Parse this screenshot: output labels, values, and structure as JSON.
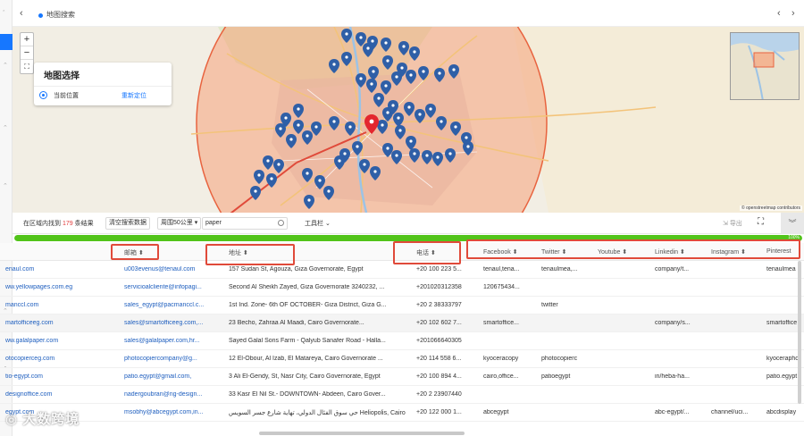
{
  "topbar": {
    "back": "‹",
    "title": "地图搜索",
    "prev": "‹",
    "next": "›"
  },
  "map": {
    "zoom_in": "+",
    "zoom_out": "−",
    "locate": "⛶",
    "panel_title": "地图选择",
    "current_position": "当前位置",
    "relocate": "重新定位",
    "attribution": "© openstreetmap contributors"
  },
  "toolbar": {
    "count_prefix": "在区域内找到",
    "count": "179",
    "count_suffix": "条结果",
    "clear_button": "清空搜索数据",
    "radius_select": "周围50公里",
    "search_value": "paper",
    "tools_label": "工具栏",
    "export_label": "导出"
  },
  "progress": {
    "percent": 100,
    "label": "100%"
  },
  "table": {
    "headers": [
      "邮箱",
      "地址",
      "电话",
      "Facebook",
      "Twitter",
      "Youtube",
      "Linkedin",
      "Instagram",
      "Pinterest"
    ],
    "rows": [
      {
        "web": "enaul.com",
        "email": "u003evenus@tenaul.com",
        "address": "157 Sudan St, Agouza, Giza Governorate, Egypt",
        "phone": "+20 100 223 5...",
        "facebook": "tenaul,tena...",
        "twitter": "tenaulmea,...",
        "youtube": "",
        "linkedin": "company/t...",
        "instagram": "",
        "pinterest": "tenaulmea"
      },
      {
        "web": "ww.yellowpages.com.eg",
        "email": "servicioalcliente@infopagi...",
        "address": "Second Al Sheikh Zayed, Giza Governorate 3240232, ...",
        "phone": "+201020312358",
        "facebook": "120675434...",
        "twitter": "",
        "youtube": "",
        "linkedin": "",
        "instagram": "",
        "pinterest": ""
      },
      {
        "web": "manccl.com",
        "email": "sales_egypt@pacmanccl.c...",
        "address": "1st Ind. Zone- 6th OF OCTOBER- Giza District, Giza G...",
        "phone": "+20 2 38333797",
        "facebook": "",
        "twitter": "twitter",
        "youtube": "",
        "linkedin": "",
        "instagram": "",
        "pinterest": ""
      },
      {
        "web": "martofficeeg.com",
        "email": "sales@smartofficeeg.com,...",
        "address": "23 Becho, Zahraa Al Maadi, Cairo Governorate...",
        "phone": "+20 102 602 7...",
        "facebook": "smartoffice...",
        "twitter": "",
        "youtube": "",
        "linkedin": "company/s...",
        "instagram": "",
        "pinterest": "smartoffice"
      },
      {
        "web": "ww.galalpaper.com",
        "email": "sales@galalpaper.com,hr...",
        "address": "Sayed Galal Sons Farm - Qalyub Sanafer Road - Halla...",
        "phone": "+201066640305",
        "facebook": "",
        "twitter": "",
        "youtube": "",
        "linkedin": "",
        "instagram": "",
        "pinterest": ""
      },
      {
        "web": "otocopierceg.com",
        "email": "photocopiercompany@g...",
        "address": "12 El-Obour, Al Izab, El Matareya, Cairo Governorate ...",
        "phone": "+20 114 558 6...",
        "facebook": "kyoceracopy",
        "twitter": "photocopierc",
        "youtube": "",
        "linkedin": "",
        "instagram": "",
        "pinterest": "kyocerapho"
      },
      {
        "web": "tio-egypt.com",
        "email": "patio.egypt@gmail.com,",
        "address": "3 Ali El-Gendy, St, Nasr City, Cairo Governorate, Egypt",
        "phone": "+20 100 894 4...",
        "facebook": "cairo,office...",
        "twitter": "patioegypt",
        "youtube": "",
        "linkedin": "in/heba-ha...",
        "instagram": "",
        "pinterest": "patio.egypt"
      },
      {
        "web": "designoffice.com",
        "email": "nadergoubran@ng-design...",
        "address": "33 Kasr El Nil St.- DOWNTOWN- Abdeen, Cairo Gover...",
        "phone": "+20 2 23907440",
        "facebook": "",
        "twitter": "",
        "youtube": "",
        "linkedin": "",
        "instagram": "",
        "pinterest": ""
      },
      {
        "web": "egypt.com",
        "email": "msobhy@abcegypt.com,in...",
        "address": "حي سوق الفئال الدولي، تهاية شارع جسر السويس Heliopolis, Cairo G...",
        "phone": "+20 122 000 1...",
        "facebook": "abcegypt",
        "twitter": "",
        "youtube": "",
        "linkedin": "abc-egypt/...",
        "instagram": "channel/uci...",
        "pinterest": "abcdisplay"
      }
    ]
  },
  "watermark": "大数跨境",
  "colors": {
    "accent": "#1677ff",
    "progress": "#52c41a",
    "marker": "#2f5fa7",
    "annotation": "#e04a3a"
  }
}
